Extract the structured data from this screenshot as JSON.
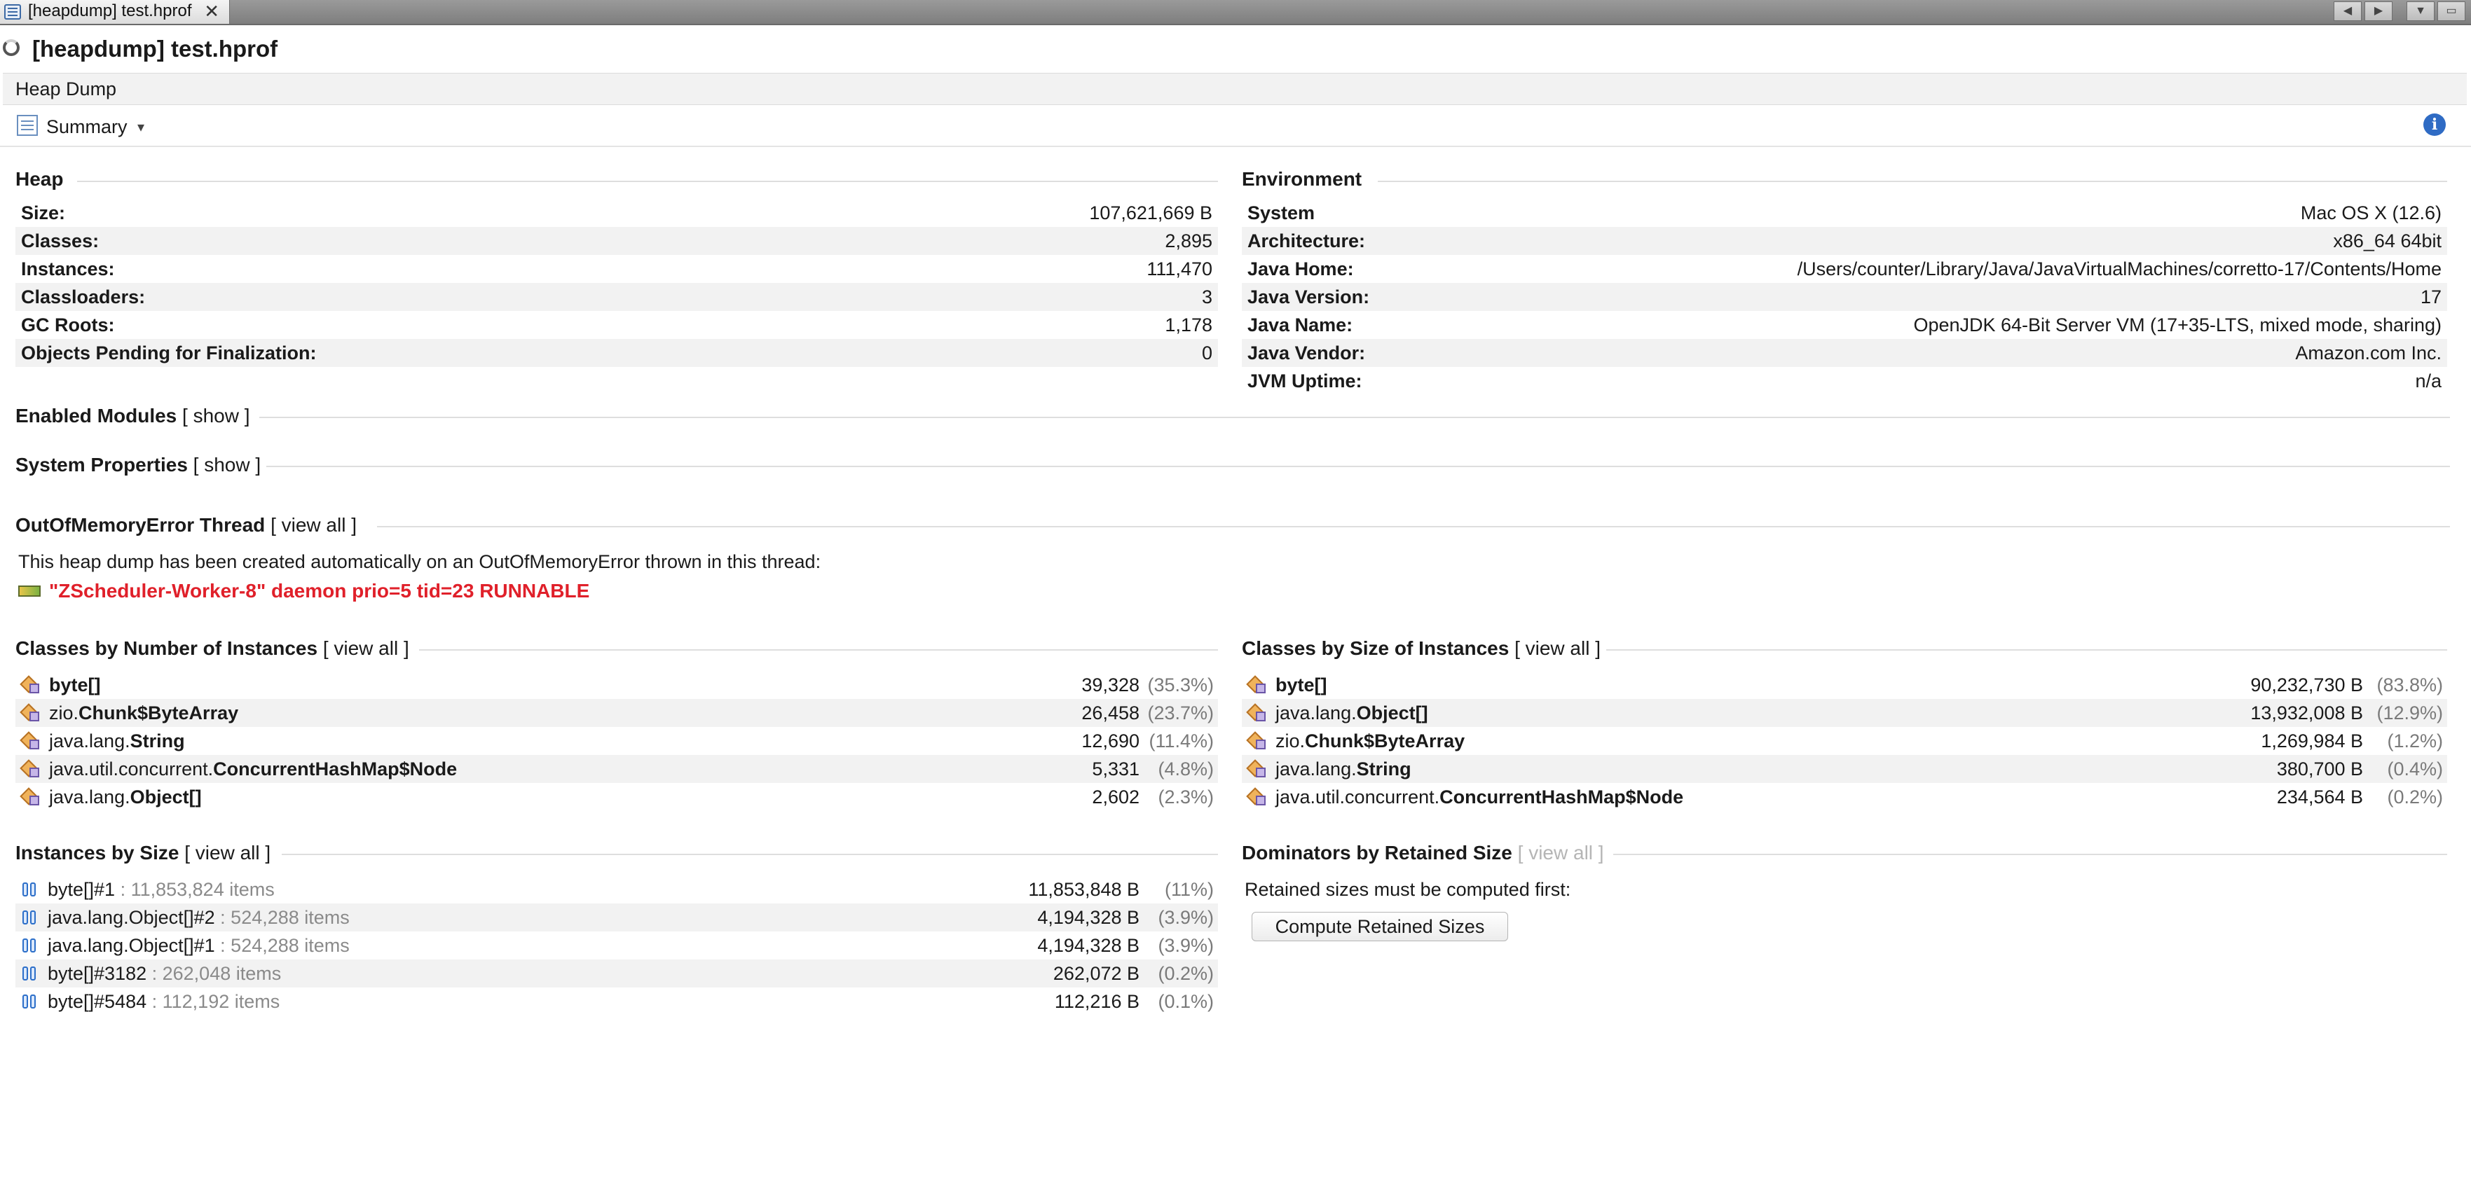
{
  "tab": {
    "title": "[heapdump] test.hprof",
    "close": "✕"
  },
  "title": "[heapdump] test.hprof",
  "section_header": "Heap Dump",
  "view_selector": {
    "label": "Summary",
    "arrow": "▾"
  },
  "info_icon": "i",
  "heap": {
    "title": "Heap",
    "rows": [
      {
        "label": "Size:",
        "value": "107,621,669 B"
      },
      {
        "label": "Classes:",
        "value": "2,895"
      },
      {
        "label": "Instances:",
        "value": "111,470"
      },
      {
        "label": "Classloaders:",
        "value": "3"
      },
      {
        "label": "GC Roots:",
        "value": "1,178"
      },
      {
        "label": "Objects Pending for Finalization:",
        "value": "0"
      }
    ]
  },
  "environment": {
    "title": "Environment",
    "rows": [
      {
        "label": "System",
        "value": "Mac OS X (12.6)"
      },
      {
        "label": "Architecture:",
        "value": "x86_64 64bit"
      },
      {
        "label": "Java Home:",
        "value": "/Users/counter/Library/Java/JavaVirtualMachines/corretto-17/Contents/Home"
      },
      {
        "label": "Java Version:",
        "value": "17"
      },
      {
        "label": "Java Name:",
        "value": "OpenJDK 64-Bit Server VM (17+35-LTS, mixed mode, sharing)"
      },
      {
        "label": "Java Vendor:",
        "value": "Amazon.com Inc."
      },
      {
        "label": "JVM Uptime:",
        "value": "n/a"
      }
    ]
  },
  "enabled_modules": {
    "title": "Enabled Modules",
    "link": "[ show ]"
  },
  "system_properties": {
    "title": "System Properties",
    "link": "[ show ]"
  },
  "oom_thread": {
    "title": "OutOfMemoryError Thread",
    "link": "[ view all ]",
    "description": "This heap dump has been created automatically on an OutOfMemoryError thrown in this thread:",
    "thread": "\"ZScheduler-Worker-8\" daemon prio=5 tid=23 RUNNABLE"
  },
  "classes_by_count": {
    "title": "Classes by Number of Instances",
    "link": "[ view all ]",
    "rows": [
      {
        "pkg": "",
        "name": "byte[]",
        "value": "39,328",
        "pct": "(35.3%)"
      },
      {
        "pkg": "zio.",
        "name": "Chunk$ByteArray",
        "value": "26,458",
        "pct": "(23.7%)"
      },
      {
        "pkg": "java.lang.",
        "name": "String",
        "value": "12,690",
        "pct": "(11.4%)"
      },
      {
        "pkg": "java.util.concurrent.",
        "name": "ConcurrentHashMap$Node",
        "value": "5,331",
        "pct": "(4.8%)"
      },
      {
        "pkg": "java.lang.",
        "name": "Object[]",
        "value": "2,602",
        "pct": "(2.3%)"
      }
    ]
  },
  "classes_by_size": {
    "title": "Classes by Size of Instances",
    "link": "[ view all ]",
    "rows": [
      {
        "pkg": "",
        "name": "byte[]",
        "value": "90,232,730 B",
        "pct": "(83.8%)"
      },
      {
        "pkg": "java.lang.",
        "name": "Object[]",
        "value": "13,932,008 B",
        "pct": "(12.9%)"
      },
      {
        "pkg": "zio.",
        "name": "Chunk$ByteArray",
        "value": "1,269,984 B",
        "pct": "(1.2%)"
      },
      {
        "pkg": "java.lang.",
        "name": "String",
        "value": "380,700 B",
        "pct": "(0.4%)"
      },
      {
        "pkg": "java.util.concurrent.",
        "name": "ConcurrentHashMap$Node",
        "value": "234,564 B",
        "pct": "(0.2%)"
      }
    ]
  },
  "instances_by_size": {
    "title": "Instances by Size",
    "link": "[ view all ]",
    "rows": [
      {
        "pkg": "",
        "name": "byte[]#1",
        "items": " : 11,853,824 items",
        "value": "11,853,848 B",
        "pct": "(11%)"
      },
      {
        "pkg": "java.lang.",
        "name": "Object[]#2",
        "items": " : 524,288 items",
        "value": "4,194,328 B",
        "pct": "(3.9%)"
      },
      {
        "pkg": "java.lang.",
        "name": "Object[]#1",
        "items": " : 524,288 items",
        "value": "4,194,328 B",
        "pct": "(3.9%)"
      },
      {
        "pkg": "",
        "name": "byte[]#3182",
        "items": " : 262,048 items",
        "value": "262,072 B",
        "pct": "(0.2%)"
      },
      {
        "pkg": "",
        "name": "byte[]#5484",
        "items": " : 112,192 items",
        "value": "112,216 B",
        "pct": "(0.1%)"
      }
    ]
  },
  "dominators": {
    "title": "Dominators by Retained Size",
    "link": "[ view all ]",
    "note": "Retained sizes must be computed first:",
    "button": "Compute Retained Sizes"
  }
}
